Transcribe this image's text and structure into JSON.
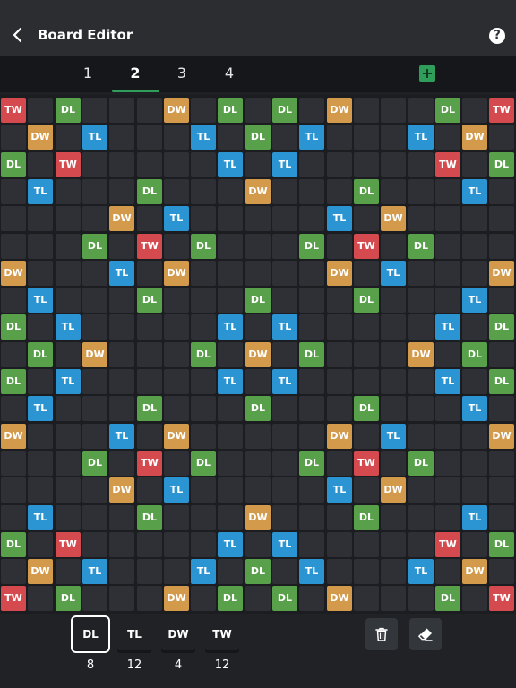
{
  "header": {
    "title": "Board Editor",
    "help_label": "?"
  },
  "tabs": [
    {
      "label": "1"
    },
    {
      "label": "2"
    },
    {
      "label": "3"
    },
    {
      "label": "4"
    }
  ],
  "active_tab": "2",
  "add_tab_icon": "plus-icon",
  "colors": {
    "DL": "#58a04a",
    "TL": "#2b95d4",
    "DW": "#d49a4c",
    "TW": "#d44a4f",
    "empty": "#2e3036",
    "accent": "#2f9e5b",
    "background": "#1e2024"
  },
  "board": {
    "size": 19,
    "rows": [
      [
        "TW",
        "",
        "DL",
        "",
        "",
        "",
        "DW",
        "",
        "DL",
        "",
        "DL",
        "",
        "DW",
        "",
        "",
        "",
        "DL",
        "",
        "TW"
      ],
      [
        "",
        "DW",
        "",
        "TL",
        "",
        "",
        "",
        "TL",
        "",
        "DL",
        "",
        "TL",
        "",
        "",
        "",
        "TL",
        "",
        "DW",
        ""
      ],
      [
        "DL",
        "",
        "TW",
        "",
        "",
        "",
        "",
        "",
        "TL",
        "",
        "TL",
        "",
        "",
        "",
        "",
        "",
        "TW",
        "",
        "DL"
      ],
      [
        "",
        "TL",
        "",
        "",
        "",
        "DL",
        "",
        "",
        "",
        "DW",
        "",
        "",
        "",
        "DL",
        "",
        "",
        "",
        "TL",
        ""
      ],
      [
        "",
        "",
        "",
        "",
        "DW",
        "",
        "TL",
        "",
        "",
        "",
        "",
        "",
        "TL",
        "",
        "DW",
        "",
        "",
        "",
        ""
      ],
      [
        "",
        "",
        "",
        "DL",
        "",
        "TW",
        "",
        "DL",
        "",
        "",
        "",
        "DL",
        "",
        "TW",
        "",
        "DL",
        "",
        "",
        ""
      ],
      [
        "DW",
        "",
        "",
        "",
        "TL",
        "",
        "DW",
        "",
        "",
        "",
        "",
        "",
        "DW",
        "",
        "TL",
        "",
        "",
        "",
        "DW"
      ],
      [
        "",
        "TL",
        "",
        "",
        "",
        "DL",
        "",
        "",
        "",
        "DL",
        "",
        "",
        "",
        "DL",
        "",
        "",
        "",
        "TL",
        ""
      ],
      [
        "DL",
        "",
        "TL",
        "",
        "",
        "",
        "",
        "",
        "TL",
        "",
        "TL",
        "",
        "",
        "",
        "",
        "",
        "TL",
        "",
        "DL"
      ],
      [
        "",
        "DL",
        "",
        "DW",
        "",
        "",
        "",
        "DL",
        "",
        "DW",
        "",
        "DL",
        "",
        "",
        "",
        "DW",
        "",
        "DL",
        ""
      ],
      [
        "DL",
        "",
        "TL",
        "",
        "",
        "",
        "",
        "",
        "TL",
        "",
        "TL",
        "",
        "",
        "",
        "",
        "",
        "TL",
        "",
        "DL"
      ],
      [
        "",
        "TL",
        "",
        "",
        "",
        "DL",
        "",
        "",
        "",
        "DL",
        "",
        "",
        "",
        "DL",
        "",
        "",
        "",
        "TL",
        ""
      ],
      [
        "DW",
        "",
        "",
        "",
        "TL",
        "",
        "DW",
        "",
        "",
        "",
        "",
        "",
        "DW",
        "",
        "TL",
        "",
        "",
        "",
        "DW"
      ],
      [
        "",
        "",
        "",
        "DL",
        "",
        "TW",
        "",
        "DL",
        "",
        "",
        "",
        "DL",
        "",
        "TW",
        "",
        "DL",
        "",
        "",
        ""
      ],
      [
        "",
        "",
        "",
        "",
        "DW",
        "",
        "TL",
        "",
        "",
        "",
        "",
        "",
        "TL",
        "",
        "DW",
        "",
        "",
        "",
        ""
      ],
      [
        "",
        "TL",
        "",
        "",
        "",
        "DL",
        "",
        "",
        "",
        "DW",
        "",
        "",
        "",
        "DL",
        "",
        "",
        "",
        "TL",
        ""
      ],
      [
        "DL",
        "",
        "TW",
        "",
        "",
        "",
        "",
        "",
        "TL",
        "",
        "TL",
        "",
        "",
        "",
        "",
        "",
        "TW",
        "",
        "DL"
      ],
      [
        "",
        "DW",
        "",
        "TL",
        "",
        "",
        "",
        "TL",
        "",
        "DL",
        "",
        "TL",
        "",
        "",
        "",
        "TL",
        "",
        "DW",
        ""
      ],
      [
        "TW",
        "",
        "DL",
        "",
        "",
        "",
        "DW",
        "",
        "DL",
        "",
        "DL",
        "",
        "DW",
        "",
        "",
        "",
        "DL",
        "",
        "TW"
      ]
    ]
  },
  "palette": [
    {
      "type": "DL",
      "label": "DL",
      "count": "8",
      "selected": true
    },
    {
      "type": "TL",
      "label": "TL",
      "count": "12",
      "selected": false
    },
    {
      "type": "DW",
      "label": "DW",
      "count": "4",
      "selected": false
    },
    {
      "type": "TW",
      "label": "TW",
      "count": "12",
      "selected": false
    }
  ],
  "tools": [
    {
      "name": "delete-button",
      "icon": "trash-icon"
    },
    {
      "name": "eraser-button",
      "icon": "eraser-icon"
    }
  ]
}
